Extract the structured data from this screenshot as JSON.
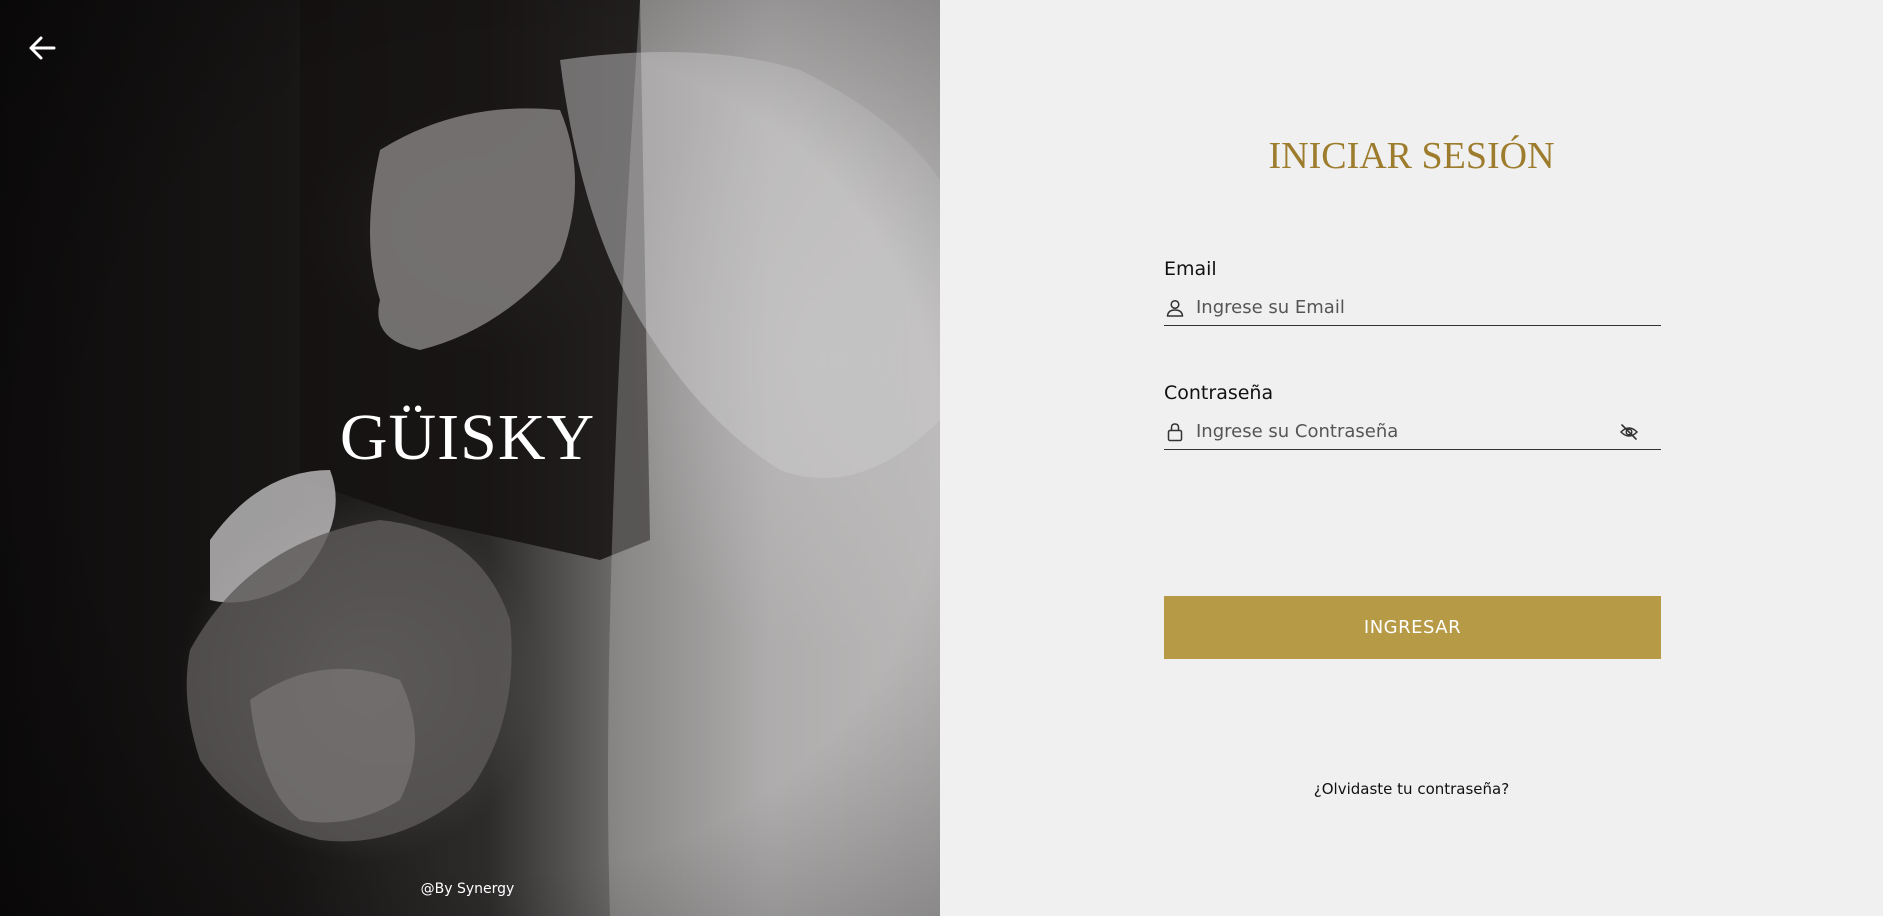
{
  "brand": {
    "title": "GÜISKY",
    "credit": "@By Synergy"
  },
  "icons": {
    "back": "arrow-left-icon",
    "email": "user-icon",
    "password": "lock-icon",
    "toggle": "eye-off-icon"
  },
  "login": {
    "title": "INICIAR SESIÓN",
    "email_label": "Email",
    "email_placeholder": "Ingrese su Email",
    "password_label": "Contraseña",
    "password_placeholder": "Ingrese su Contraseña",
    "submit_label": "INGRESAR",
    "forgot_label": "¿Olvidaste tu contraseña?"
  },
  "colors": {
    "accent": "#b79a45",
    "title_gold": "#9d7d2d",
    "background": "#f0f0f0"
  }
}
